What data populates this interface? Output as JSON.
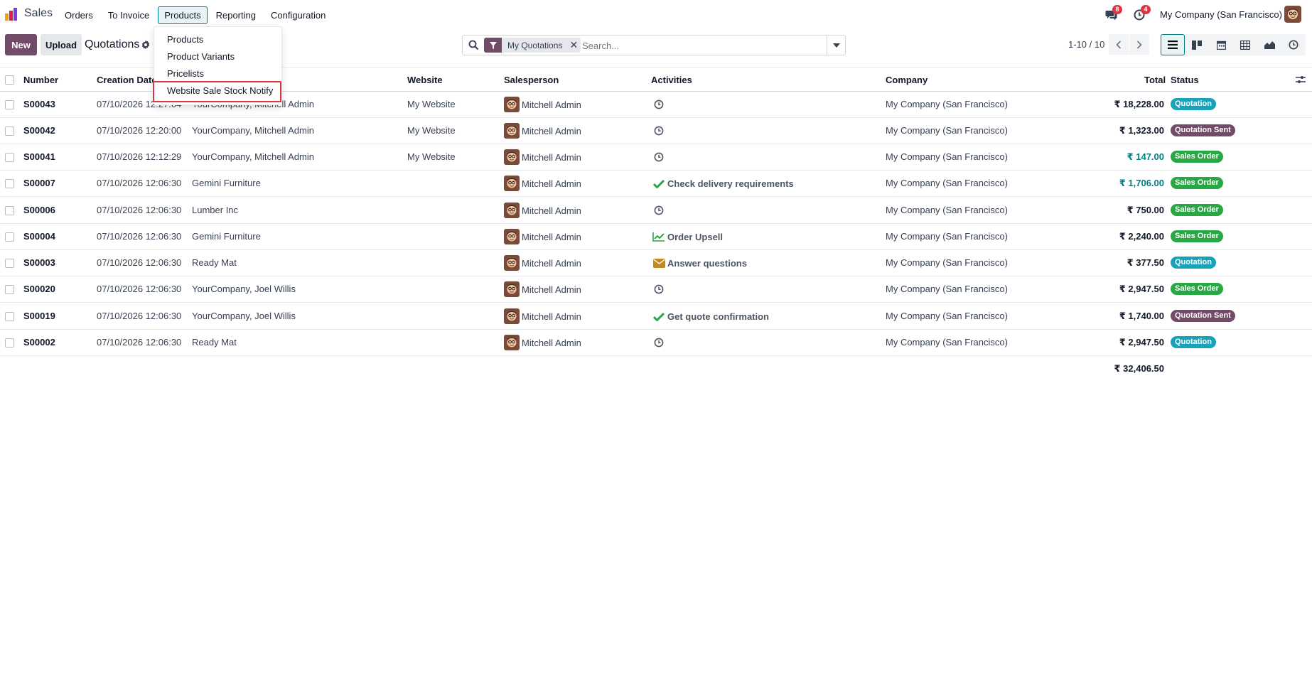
{
  "app": {
    "name": "Sales",
    "brand_color": "#714b67",
    "accent_color": "#017e84"
  },
  "nav": {
    "items": [
      {
        "label": "Orders"
      },
      {
        "label": "To Invoice"
      },
      {
        "label": "Products"
      },
      {
        "label": "Reporting"
      },
      {
        "label": "Configuration"
      }
    ],
    "active": "Products"
  },
  "systray": {
    "messages_badge": "8",
    "activities_badge": "4",
    "company": "My Company (San Francisco)"
  },
  "dropdown": {
    "items": [
      {
        "label": "Products"
      },
      {
        "label": "Product Variants"
      },
      {
        "label": "Pricelists"
      },
      {
        "label": "Website Sale Stock Notify"
      }
    ],
    "highlighted": "Website Sale Stock Notify"
  },
  "control": {
    "new_label": "New",
    "upload_label": "Upload",
    "title": "Quotations",
    "facet_label": "My Quotations",
    "search_placeholder": "Search...",
    "pager": "1-10 / 10"
  },
  "table": {
    "headers": {
      "number": "Number",
      "creation_date": "Creation Date",
      "website": "Website",
      "salesperson": "Salesperson",
      "activities": "Activities",
      "company": "Company",
      "total": "Total",
      "status": "Status"
    },
    "rows": [
      {
        "number": "S00043",
        "date": "07/10/2026 12:27:04",
        "customer": "YourCompany, Mitchell Admin",
        "website": "My Website",
        "salesperson": "Mitchell Admin",
        "activity_icon": "clock-icon",
        "activity": "",
        "company": "My Company (San Francisco)",
        "total": "₹ 18,228.00",
        "status": "Quotation"
      },
      {
        "number": "S00042",
        "date": "07/10/2026 12:20:00",
        "customer": "YourCompany, Mitchell Admin",
        "website": "My Website",
        "salesperson": "Mitchell Admin",
        "activity_icon": "clock-icon",
        "activity": "",
        "company": "My Company (San Francisco)",
        "total": "₹ 1,323.00",
        "status": "Quotation Sent"
      },
      {
        "number": "S00041",
        "date": "07/10/2026 12:12:29",
        "customer": "YourCompany, Mitchell Admin",
        "website": "My Website",
        "salesperson": "Mitchell Admin",
        "activity_icon": "clock-icon",
        "activity": "",
        "company": "My Company (San Francisco)",
        "total": "₹ 147.00",
        "status": "Sales Order"
      },
      {
        "number": "S00007",
        "date": "07/10/2026 12:06:30",
        "customer": "Gemini Furniture",
        "website": "",
        "salesperson": "Mitchell Admin",
        "activity_icon": "check-icon",
        "activity": "Check delivery requirements",
        "company": "My Company (San Francisco)",
        "total": "₹ 1,706.00",
        "status": "Sales Order"
      },
      {
        "number": "S00006",
        "date": "07/10/2026 12:06:30",
        "customer": "Lumber Inc",
        "website": "",
        "salesperson": "Mitchell Admin",
        "activity_icon": "clock-icon",
        "activity": "",
        "company": "My Company (San Francisco)",
        "total": "₹ 750.00",
        "status": "Sales Order"
      },
      {
        "number": "S00004",
        "date": "07/10/2026 12:06:30",
        "customer": "Gemini Furniture",
        "website": "",
        "salesperson": "Mitchell Admin",
        "activity_icon": "chart-line-icon",
        "activity": "Order Upsell",
        "company": "My Company (San Francisco)",
        "total": "₹ 2,240.00",
        "status": "Sales Order"
      },
      {
        "number": "S00003",
        "date": "07/10/2026 12:06:30",
        "customer": "Ready Mat",
        "website": "",
        "salesperson": "Mitchell Admin",
        "activity_icon": "envelope-icon",
        "activity": "Answer questions",
        "company": "My Company (San Francisco)",
        "total": "₹ 377.50",
        "status": "Quotation"
      },
      {
        "number": "S00020",
        "date": "07/10/2026 12:06:30",
        "customer": "YourCompany, Joel Willis",
        "website": "",
        "salesperson": "Mitchell Admin",
        "activity_icon": "clock-icon",
        "activity": "",
        "company": "My Company (San Francisco)",
        "total": "₹ 2,947.50",
        "status": "Sales Order"
      },
      {
        "number": "S00019",
        "date": "07/10/2026 12:06:30",
        "customer": "YourCompany, Joel Willis",
        "website": "",
        "salesperson": "Mitchell Admin",
        "activity_icon": "check-icon",
        "activity": "Get quote confirmation",
        "company": "My Company (San Francisco)",
        "total": "₹ 1,740.00",
        "status": "Quotation Sent"
      },
      {
        "number": "S00002",
        "date": "07/10/2026 12:06:30",
        "customer": "Ready Mat",
        "website": "",
        "salesperson": "Mitchell Admin",
        "activity_icon": "clock-icon",
        "activity": "",
        "company": "My Company (San Francisco)",
        "total": "₹ 2,947.50",
        "status": "Quotation"
      }
    ],
    "grand_total": "₹ 32,406.50"
  },
  "status_colors": {
    "Quotation": "#17a2b8",
    "Quotation Sent": "#714b67",
    "Sales Order": "#28a745"
  }
}
